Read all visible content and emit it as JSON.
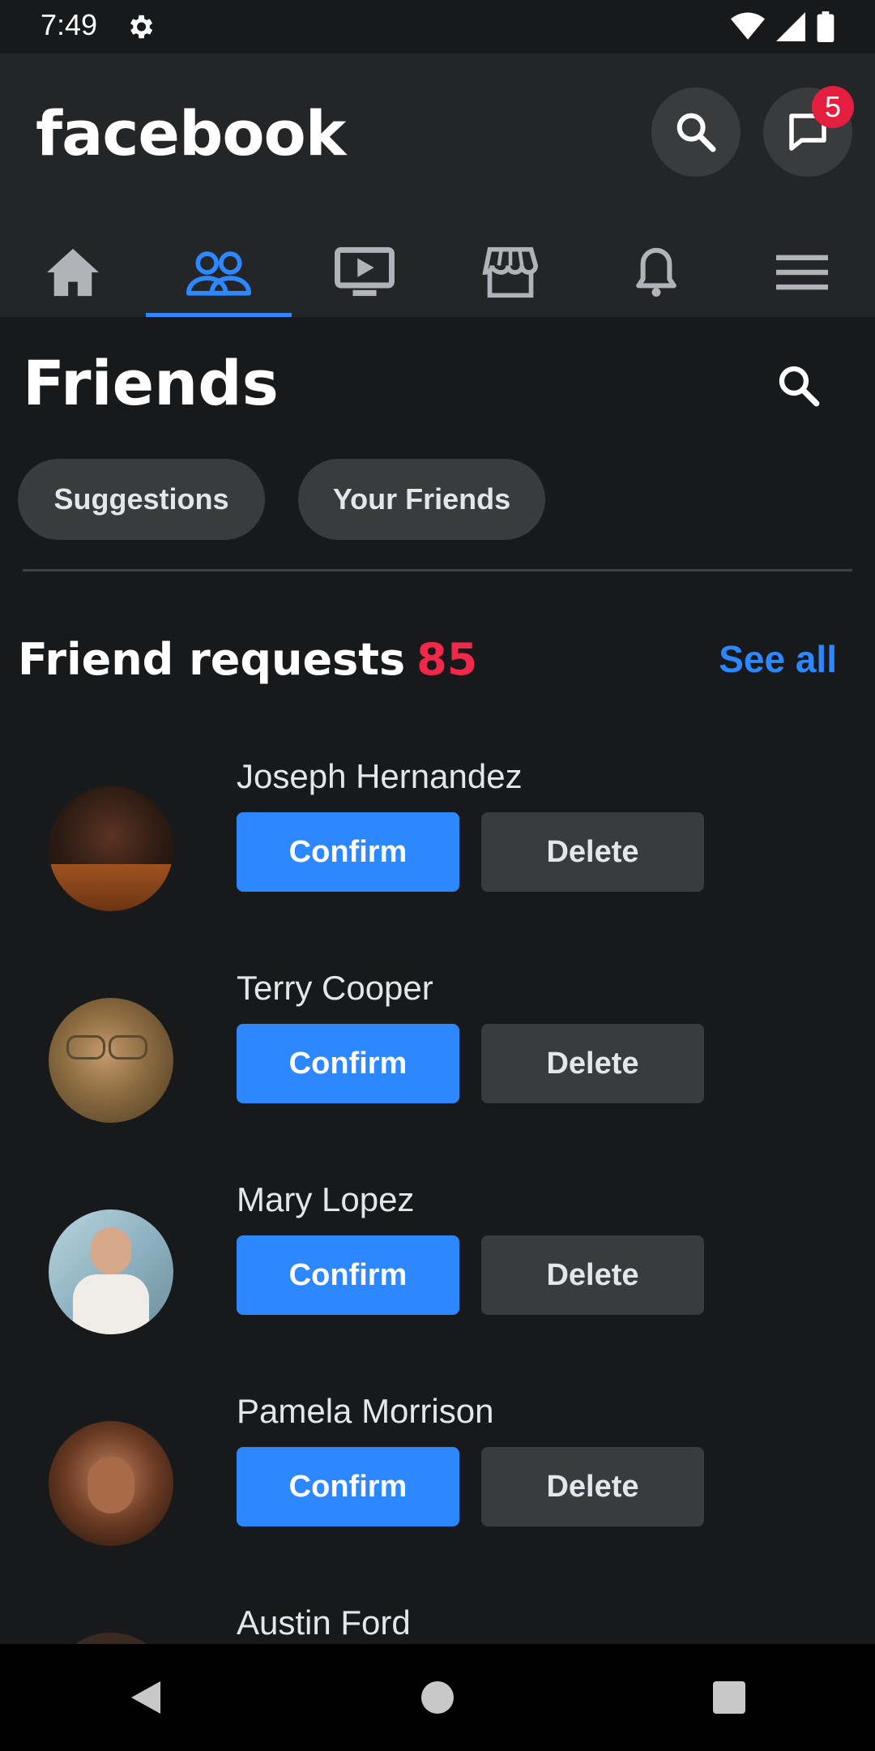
{
  "status_bar": {
    "time": "7:49"
  },
  "app_bar": {
    "logo": "facebook",
    "messenger_badge": "5"
  },
  "nav_tabs": [
    {
      "icon": "home-icon",
      "active": false
    },
    {
      "icon": "friends-icon",
      "active": true
    },
    {
      "icon": "video-icon",
      "active": false
    },
    {
      "icon": "marketplace-icon",
      "active": false
    },
    {
      "icon": "bell-icon",
      "active": false
    },
    {
      "icon": "menu-icon",
      "active": false
    }
  ],
  "page": {
    "title": "Friends",
    "chips": {
      "suggestions": "Suggestions",
      "your_friends": "Your Friends"
    }
  },
  "requests_section": {
    "title": "Friend requests",
    "count": "85",
    "see_all": "See all"
  },
  "requests": [
    {
      "name": "Joseph Hernandez",
      "confirm": "Confirm",
      "delete": "Delete"
    },
    {
      "name": "Terry Cooper",
      "confirm": "Confirm",
      "delete": "Delete"
    },
    {
      "name": "Mary Lopez",
      "confirm": "Confirm",
      "delete": "Delete"
    },
    {
      "name": "Pamela Morrison",
      "confirm": "Confirm",
      "delete": "Delete"
    },
    {
      "name": "Austin Ford"
    }
  ],
  "colors": {
    "background": "#18191a",
    "surface": "#242526",
    "accent": "#2d88ff",
    "badge": "#e41e3f",
    "count": "#f02849"
  }
}
